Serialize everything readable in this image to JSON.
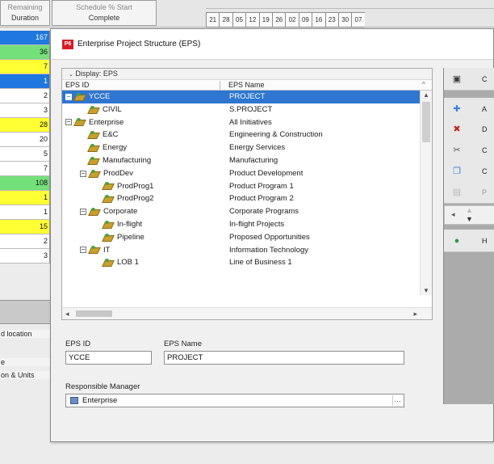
{
  "background": {
    "header": {
      "col1": [
        "Remaining",
        "Duration"
      ],
      "col2": [
        "Schedule % Start",
        "Complete"
      ],
      "timeline_days": [
        "21",
        "28",
        "05",
        "12",
        "19",
        "26",
        "02",
        "09",
        "16",
        "23",
        "30",
        "07"
      ]
    },
    "durations": [
      {
        "value": "167",
        "color": "#1f78e0",
        "text": "#ffffff"
      },
      {
        "value": "36",
        "color": "#74e07a",
        "text": "#111111"
      },
      {
        "value": "7",
        "color": "#ffff33",
        "text": "#111111"
      },
      {
        "value": "1",
        "color": "#1f78e0",
        "text": "#ffffff"
      },
      {
        "value": "2",
        "color": "#ffffff",
        "text": "#111111"
      },
      {
        "value": "3",
        "color": "#ffffff",
        "text": "#111111"
      },
      {
        "value": "28",
        "color": "#ffff33",
        "text": "#111111"
      },
      {
        "value": "20",
        "color": "#ffffff",
        "text": "#111111"
      },
      {
        "value": "5",
        "color": "#ffffff",
        "text": "#111111"
      },
      {
        "value": "7",
        "color": "#ffffff",
        "text": "#111111"
      },
      {
        "value": "108",
        "color": "#74e07a",
        "text": "#111111"
      },
      {
        "value": "1",
        "color": "#ffff33",
        "text": "#111111"
      },
      {
        "value": "1",
        "color": "#ffffff",
        "text": "#111111"
      },
      {
        "value": "15",
        "color": "#ffff33",
        "text": "#111111"
      },
      {
        "value": "2",
        "color": "#ffffff",
        "text": "#111111"
      },
      {
        "value": "3",
        "color": "#ffffff",
        "text": "#111111"
      }
    ],
    "side_labels": [
      "d location",
      "e",
      "on & Units"
    ]
  },
  "dialog": {
    "title": "Enterprise Project Structure (EPS)",
    "display_label": "Display: EPS",
    "columns": {
      "id": "EPS ID",
      "name": "EPS Name"
    },
    "rows": [
      {
        "id": "YCCE",
        "name": "PROJECT",
        "level": 0,
        "toggle": "−",
        "selected": true
      },
      {
        "id": "CIVIL",
        "name": "S.PROJECT",
        "level": 1,
        "toggle": "",
        "selected": false
      },
      {
        "id": "Enterprise",
        "name": "All Initiatives",
        "level": 0,
        "toggle": "−",
        "selected": false
      },
      {
        "id": "E&C",
        "name": "Engineering & Construction",
        "level": 1,
        "toggle": "",
        "selected": false
      },
      {
        "id": "Energy",
        "name": "Energy Services",
        "level": 1,
        "toggle": "",
        "selected": false
      },
      {
        "id": "Manufacturing",
        "name": "Manufacturing",
        "level": 1,
        "toggle": "",
        "selected": false
      },
      {
        "id": "ProdDev",
        "name": "Product Development",
        "level": 1,
        "toggle": "−",
        "selected": false
      },
      {
        "id": "ProdProg1",
        "name": "Product Program 1",
        "level": 2,
        "toggle": "",
        "selected": false
      },
      {
        "id": "ProdProg2",
        "name": "Product Program 2",
        "level": 2,
        "toggle": "",
        "selected": false
      },
      {
        "id": "Corporate",
        "name": "Corporate Programs",
        "level": 1,
        "toggle": "−",
        "selected": false
      },
      {
        "id": "In-flight",
        "name": "In-flight Projects",
        "level": 2,
        "toggle": "",
        "selected": false
      },
      {
        "id": "Pipeline",
        "name": "Proposed Opportunities",
        "level": 2,
        "toggle": "",
        "selected": false
      },
      {
        "id": "IT",
        "name": "Information Technology",
        "level": 1,
        "toggle": "−",
        "selected": false
      },
      {
        "id": "LOB 1",
        "name": "Line of Business 1",
        "level": 2,
        "toggle": "",
        "selected": false
      }
    ],
    "details": {
      "eps_id_label": "EPS ID",
      "eps_id_value": "YCCE",
      "eps_name_label": "EPS Name",
      "eps_name_value": "PROJECT",
      "manager_label": "Responsible Manager",
      "manager_value": "Enterprise"
    },
    "toolbar": [
      {
        "name": "close",
        "label": "C",
        "icon": "close-dialog-icon",
        "glyph": "▣",
        "color": "#3a3a3a"
      },
      {
        "name": "add",
        "label": "A",
        "icon": "add-icon",
        "glyph": "✚",
        "color": "#3b7fd8"
      },
      {
        "name": "delete",
        "label": "D",
        "icon": "delete-icon",
        "glyph": "✖",
        "color": "#c0281c"
      },
      {
        "name": "cut",
        "label": "C",
        "icon": "cut-icon",
        "glyph": "✂",
        "color": "#555555"
      },
      {
        "name": "copy",
        "label": "C",
        "icon": "copy-icon",
        "glyph": "❐",
        "color": "#3b7fd8"
      },
      {
        "name": "paste",
        "label": "P",
        "icon": "paste-icon",
        "glyph": "▤",
        "color": "#777777"
      },
      {
        "name": "help",
        "label": "H",
        "icon": "help-icon",
        "glyph": "●",
        "color": "#2d9a4d"
      }
    ]
  }
}
